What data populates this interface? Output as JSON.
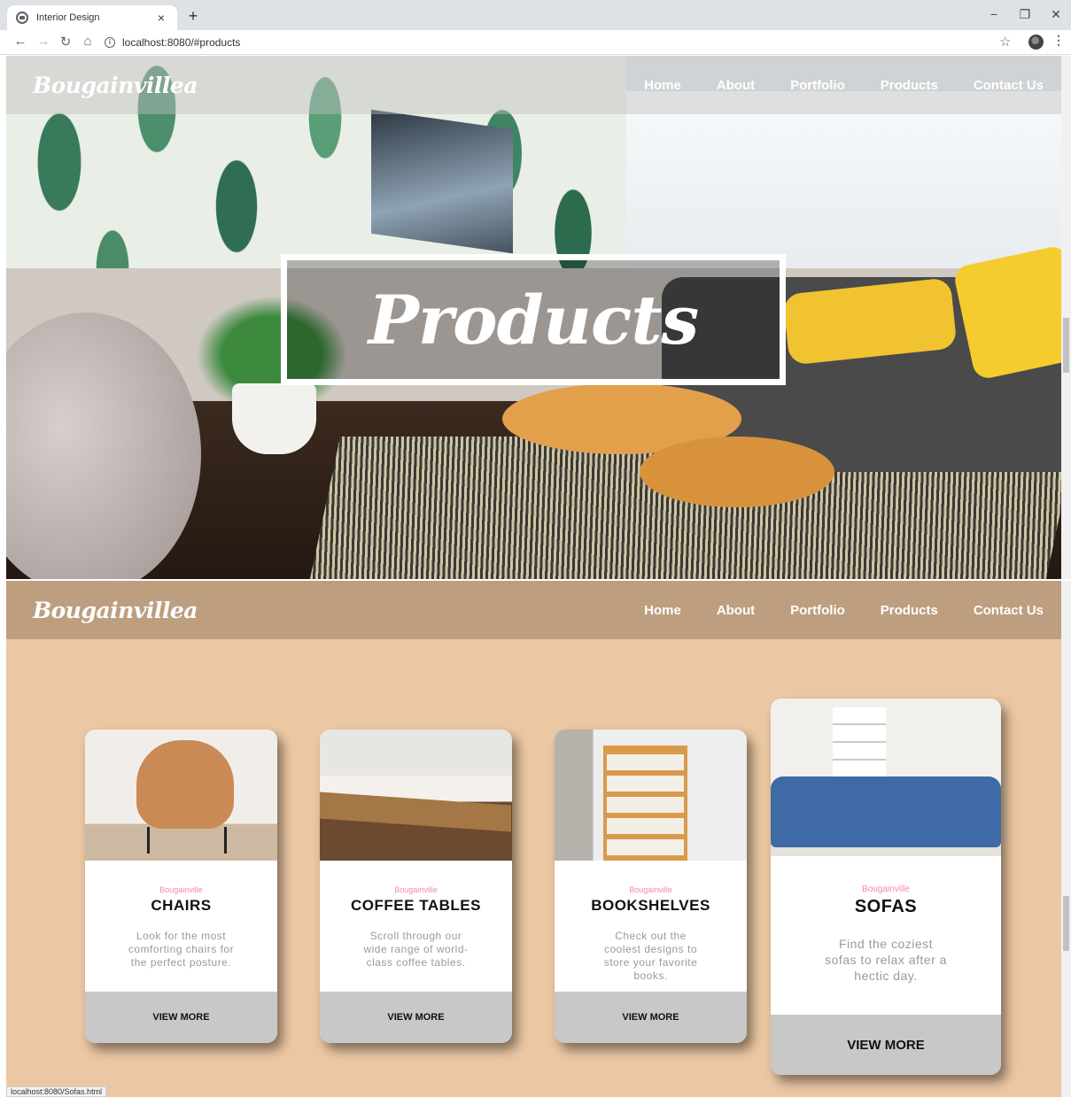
{
  "browser": {
    "tab_title": "Interior Design",
    "tab_close": "×",
    "new_tab": "+",
    "url": "localhost:8080/#products",
    "window_controls": [
      "−",
      "❐",
      "✕"
    ]
  },
  "site": {
    "brand": "Bougainvillea",
    "nav": [
      "Home",
      "About",
      "Portfolio",
      "Products",
      "Contact Us"
    ]
  },
  "hero": {
    "title": "Products"
  },
  "products": [
    {
      "brand": "Bougainville",
      "title": "CHAIRS",
      "description": "Look for the most comforting chairs for the perfect posture.",
      "cta": "VIEW MORE",
      "image": "orange-armchair"
    },
    {
      "brand": "Bougainville",
      "title": "COFFEE TABLES",
      "description": "Scroll through our wide range of world-class coffee tables.",
      "cta": "VIEW MORE",
      "image": "wooden-coffee-table"
    },
    {
      "brand": "Bougainville",
      "title": "BOOKSHELVES",
      "description": "Check out the coolest designs to store your favorite books.",
      "cta": "VIEW MORE",
      "image": "wooden-bookshelf"
    },
    {
      "brand": "Bougainville",
      "title": "SOFAS",
      "description": "Find the coziest sofas to relax after a hectic day.",
      "cta": "VIEW MORE",
      "image": "blue-sofa"
    }
  ],
  "status_url": "localhost:8080/Sofas.html",
  "colors": {
    "section_bg": "#ebc7a3",
    "navbar_solid": "#bd9e7f",
    "brand_line": "#f28aa0",
    "card_footer": "#c8c8c8"
  },
  "icons": [
    "globe-favicon-icon",
    "back-arrow-icon",
    "forward-arrow-icon",
    "reload-icon",
    "home-icon",
    "info-icon",
    "star-icon",
    "menu-dots-icon"
  ]
}
